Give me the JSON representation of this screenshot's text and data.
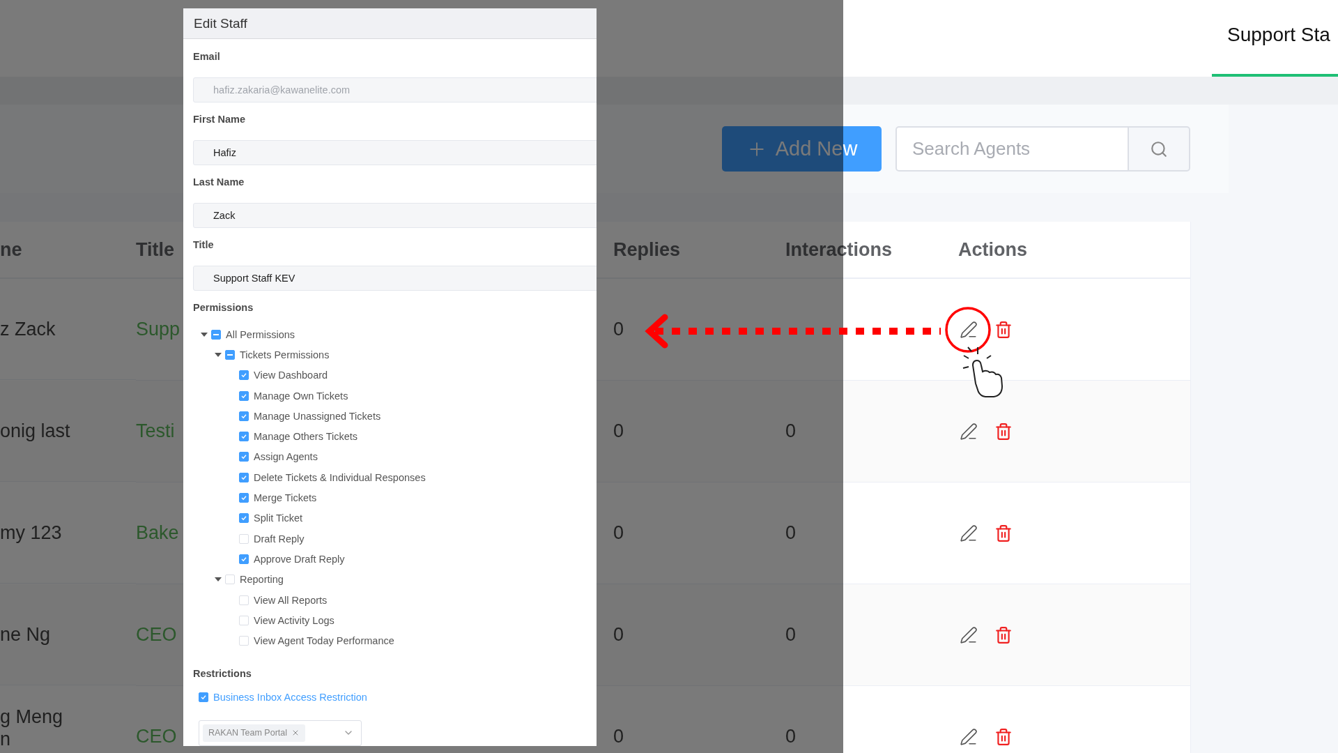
{
  "header": {
    "tabs": [
      {
        "label": "Support Sta",
        "selected": true
      }
    ]
  },
  "toolbar": {
    "add_button": {
      "label": "Add New"
    },
    "search": {
      "placeholder": "Search Agents"
    }
  },
  "table": {
    "columns": [
      "ne",
      "Title",
      "Replies",
      "Interactions",
      "Actions"
    ],
    "rows": [
      {
        "name_lines": [
          "z Zack"
        ],
        "title": "Supp",
        "replies": "0"
      },
      {
        "name_lines": [
          "onig last"
        ],
        "title": "Testi",
        "replies": "0",
        "interactions": "0"
      },
      {
        "name_lines": [
          "my 123"
        ],
        "title": "Bake",
        "replies": "0",
        "interactions": "0"
      },
      {
        "name_lines": [
          "ne Ng"
        ],
        "title": "CEO",
        "replies": "0",
        "interactions": "0"
      },
      {
        "name_lines": [
          "g Meng",
          "n"
        ],
        "title": "CEO",
        "replies": "0",
        "interactions": "0"
      }
    ]
  },
  "modal": {
    "title": "Edit Staff",
    "fields": [
      {
        "label": "Email",
        "value": "hafiz.zakaria@kawanelite.com",
        "disabled": true
      },
      {
        "label": "First Name",
        "value": "Hafiz",
        "disabled": false
      },
      {
        "label": "Last Name",
        "value": "Zack",
        "disabled": false
      },
      {
        "label": "Title",
        "value": "Support Staff KEV",
        "disabled": false
      }
    ],
    "permissions": {
      "label": "Permissions",
      "tree": [
        {
          "label": "All Permissions",
          "indeterminate": true,
          "expanded": true,
          "children": [
            {
              "label": "Tickets Permissions",
              "indeterminate": true,
              "expanded": true,
              "children": [
                {
                  "label": "View Dashboard",
                  "checked": true
                },
                {
                  "label": "Manage Own Tickets",
                  "checked": true
                },
                {
                  "label": "Manage Unassigned Tickets",
                  "checked": true
                },
                {
                  "label": "Manage Others Tickets",
                  "checked": true
                },
                {
                  "label": "Assign Agents",
                  "checked": true
                },
                {
                  "label": "Delete Tickets & Individual Responses",
                  "checked": true
                },
                {
                  "label": "Merge Tickets",
                  "checked": true
                },
                {
                  "label": "Split Ticket",
                  "checked": true
                },
                {
                  "label": "Draft Reply",
                  "checked": false
                },
                {
                  "label": "Approve Draft Reply",
                  "checked": true
                }
              ]
            },
            {
              "label": "Reporting",
              "checked": false,
              "expanded": true,
              "children": [
                {
                  "label": "View All Reports",
                  "checked": false
                },
                {
                  "label": "View Activity Logs",
                  "checked": false
                },
                {
                  "label": "View Agent Today Performance",
                  "checked": false
                }
              ]
            }
          ]
        }
      ]
    },
    "restrictions": {
      "label": "Restrictions",
      "option": {
        "label": "Business Inbox Access Restriction",
        "checked": true
      },
      "select": {
        "tags": [
          "RAKAN Team Portal"
        ]
      }
    }
  }
}
